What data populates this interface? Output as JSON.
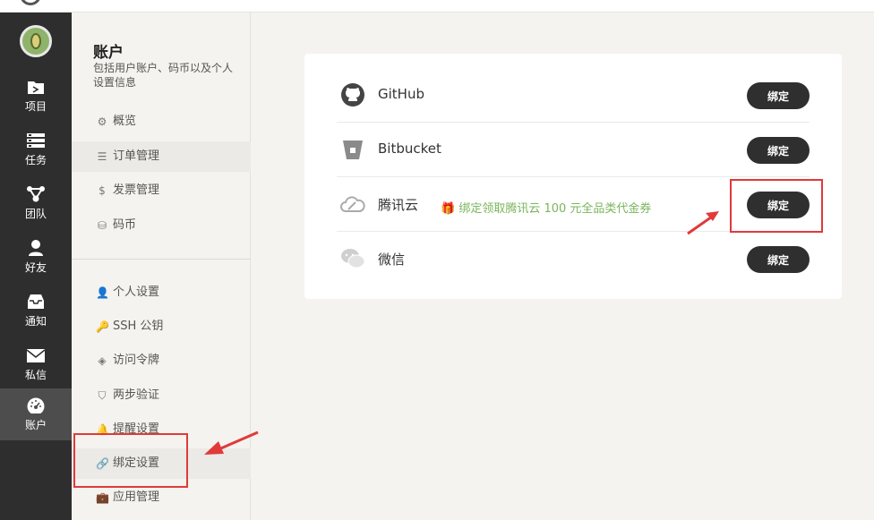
{
  "nav": {
    "items": [
      {
        "label": "项目",
        "icon": "folder-icon"
      },
      {
        "label": "任务",
        "icon": "tasks-icon"
      },
      {
        "label": "团队",
        "icon": "team-icon"
      },
      {
        "label": "好友",
        "icon": "user-icon"
      },
      {
        "label": "通知",
        "icon": "inbox-icon"
      },
      {
        "label": "私信",
        "icon": "envelope-icon"
      },
      {
        "label": "账户",
        "icon": "dashboard-icon"
      }
    ],
    "active_index": 6
  },
  "side": {
    "title": "账户",
    "desc": "包括用户账户、码币以及个人设置信息",
    "items": [
      {
        "label": "概览",
        "icon": "⚙"
      },
      {
        "label": "订单管理",
        "icon": "☰"
      },
      {
        "label": "发票管理",
        "icon": "$"
      },
      {
        "label": "码币",
        "icon": "⛁"
      },
      {
        "label": "个人设置",
        "icon": "👤"
      },
      {
        "label": "SSH 公钥",
        "icon": "🔑"
      },
      {
        "label": "访问令牌",
        "icon": "◈"
      },
      {
        "label": "两步验证",
        "icon": "⛉"
      },
      {
        "label": "提醒设置",
        "icon": "🔔"
      },
      {
        "label": "绑定设置",
        "icon": "🔗"
      },
      {
        "label": "应用管理",
        "icon": "💼"
      }
    ]
  },
  "bindings": {
    "rows": [
      {
        "name": "GitHub",
        "icon": "github-icon",
        "button": "绑定"
      },
      {
        "name": "Bitbucket",
        "icon": "bitbucket-icon",
        "button": "绑定"
      },
      {
        "name": "腾讯云",
        "icon": "cloud-icon",
        "button": "绑定",
        "promo": "绑定领取腾讯云 100 元全品类代金券"
      },
      {
        "name": "微信",
        "icon": "wechat-icon",
        "button": "绑定"
      }
    ]
  },
  "colors": {
    "nav_bg": "#2e2e2e",
    "button_bg": "#2f2f2f",
    "promo": "#7ab55c",
    "annotation": "#e03a3a"
  }
}
